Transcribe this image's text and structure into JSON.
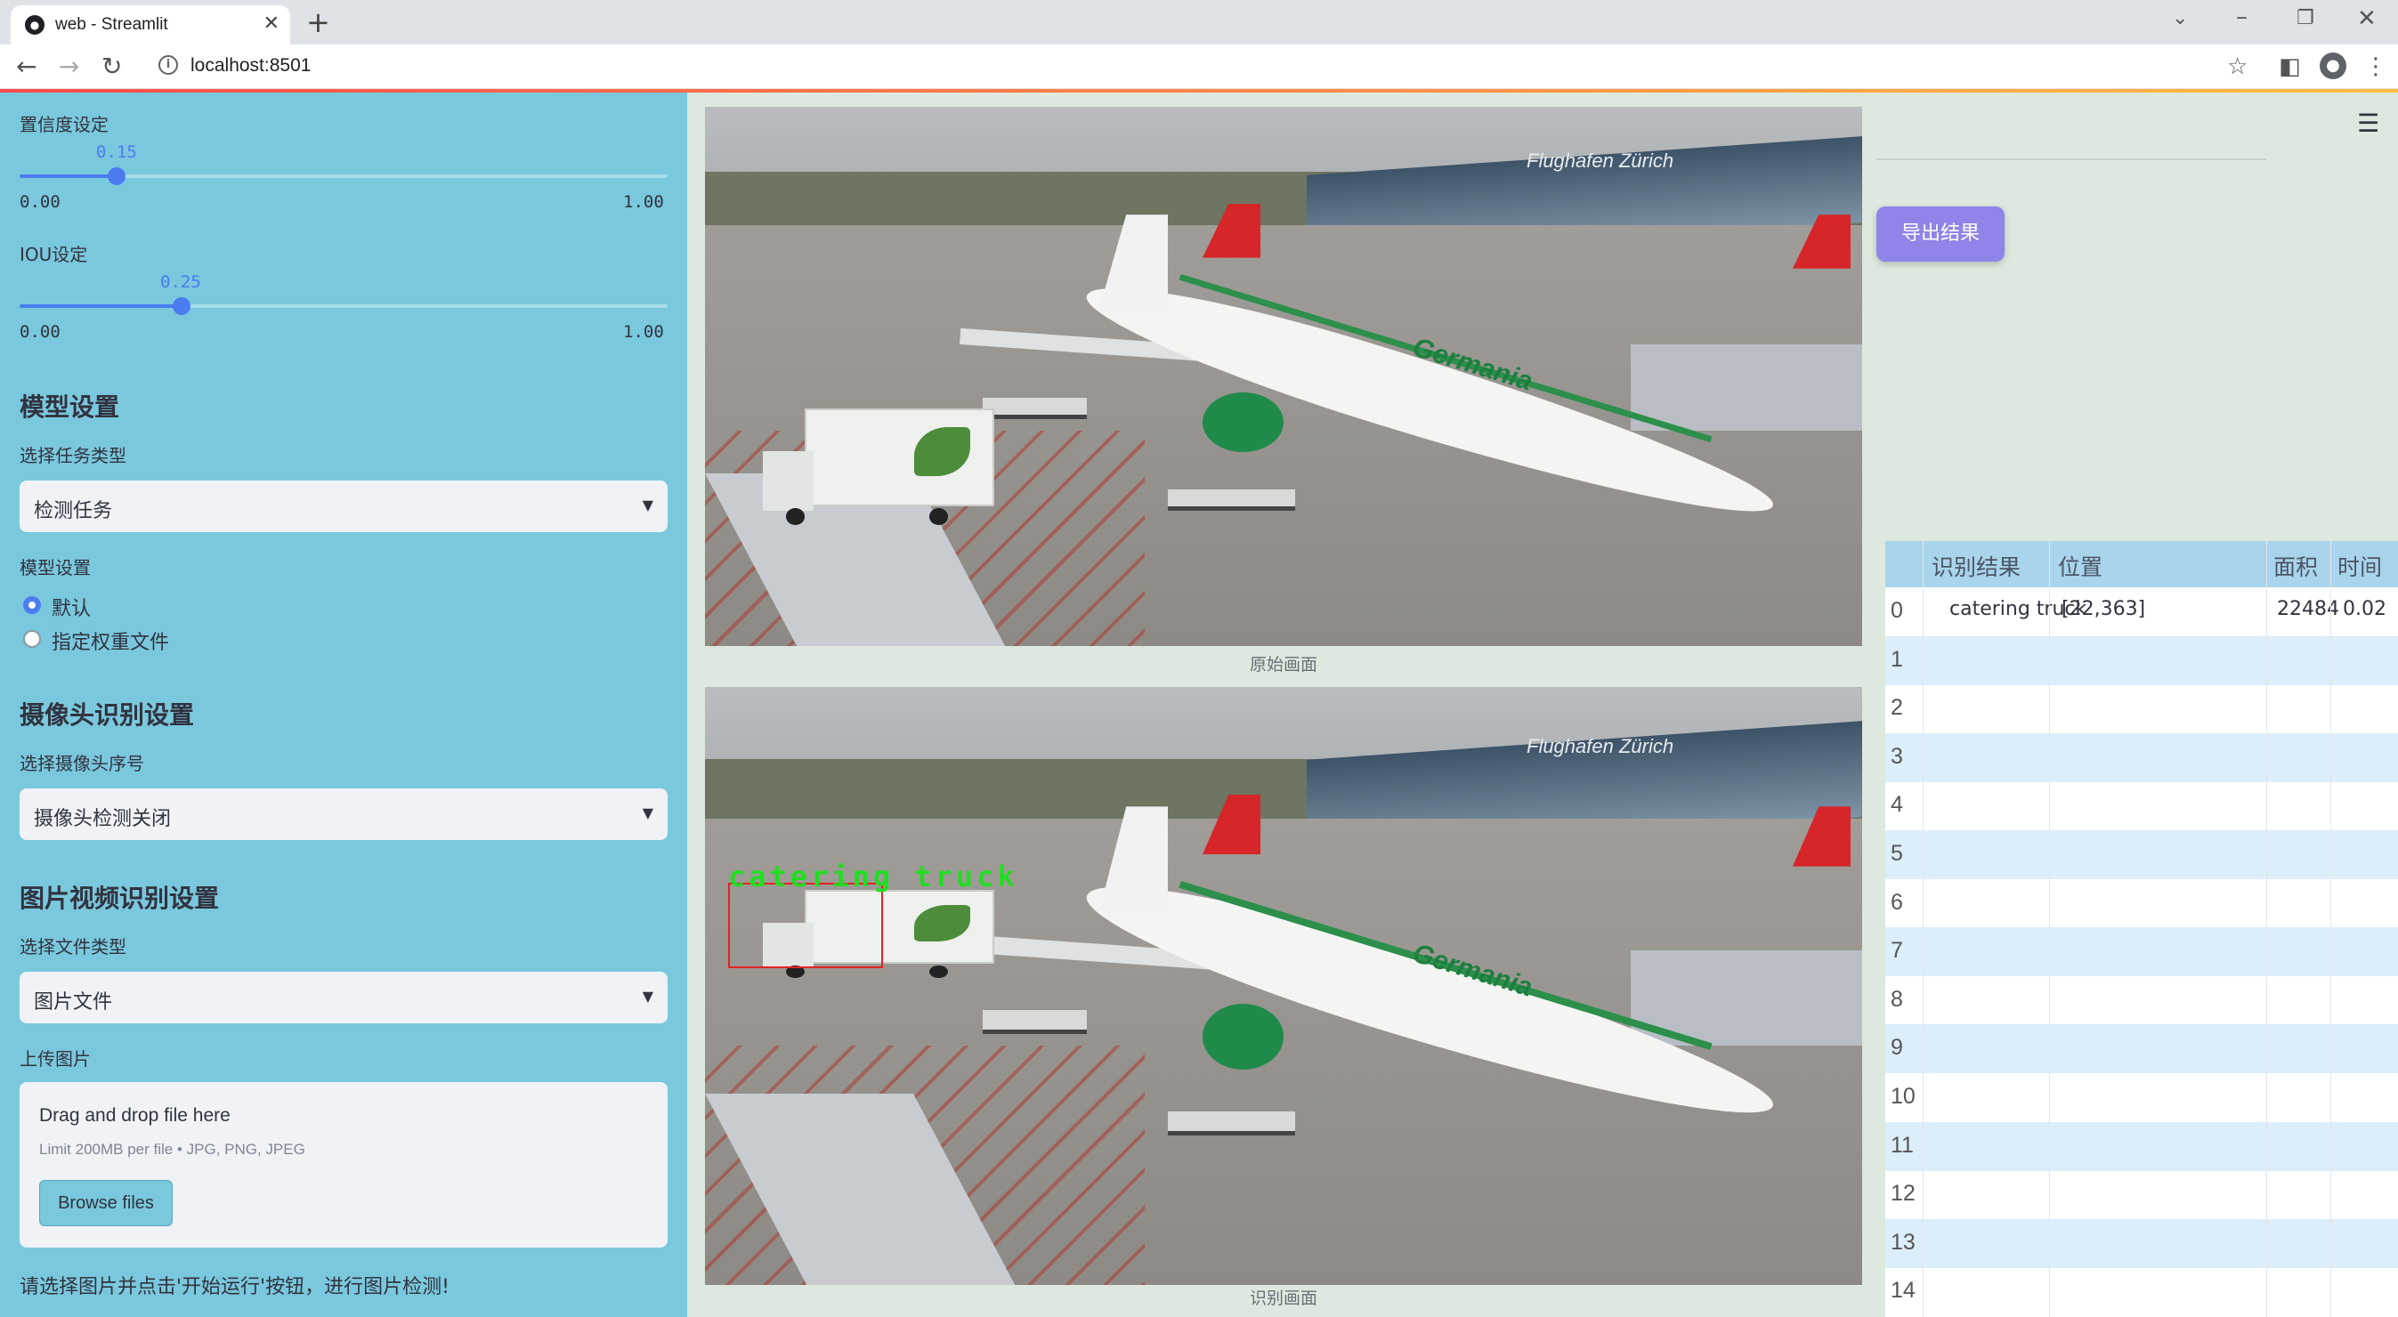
{
  "browser": {
    "tab_title": "web - Streamlit",
    "url": "localhost:8501"
  },
  "sidebar": {
    "confidence": {
      "label": "置信度设定",
      "value": "0.15",
      "value_fraction": 0.15,
      "min": "0.00",
      "max": "1.00"
    },
    "iou": {
      "label": "IOU设定",
      "value": "0.25",
      "value_fraction": 0.25,
      "min": "0.00",
      "max": "1.00"
    },
    "model_heading": "模型设置",
    "task_type_label": "选择任务类型",
    "task_type_value": "检测任务",
    "model_label": "模型设置",
    "model_options": [
      {
        "label": "默认",
        "selected": true
      },
      {
        "label": "指定权重文件",
        "selected": false
      }
    ],
    "camera_heading": "摄像头识别设置",
    "camera_label": "选择摄像头序号",
    "camera_value": "摄像头检测关闭",
    "file_heading": "图片视频识别设置",
    "file_type_label": "选择文件类型",
    "file_type_value": "图片文件",
    "upload_label": "上传图片",
    "uploader": {
      "title": "Drag and drop file here",
      "limit": "Limit 200MB per file • JPG, PNG, JPEG",
      "browse": "Browse files"
    },
    "hint": "请选择图片并点击'开始运行'按钮，进行图片检测!"
  },
  "main": {
    "original_caption": "原始画面",
    "result_caption": "识别画面",
    "detection_label": "catering truck",
    "scene_text": "Flughafen Zürich",
    "plane_text": "Germania",
    "export_button": "导出结果"
  },
  "table": {
    "headers": [
      "识别结果",
      "位置",
      "面积",
      "时间"
    ],
    "rows": [
      {
        "index": "0",
        "result": "catering truck",
        "position": "[22,363]",
        "area": "22484",
        "time": "0.02"
      },
      {
        "index": "1"
      },
      {
        "index": "2"
      },
      {
        "index": "3"
      },
      {
        "index": "4"
      },
      {
        "index": "5"
      },
      {
        "index": "6"
      },
      {
        "index": "7"
      },
      {
        "index": "8"
      },
      {
        "index": "9"
      },
      {
        "index": "10"
      },
      {
        "index": "11"
      },
      {
        "index": "12"
      },
      {
        "index": "13"
      },
      {
        "index": "14"
      }
    ]
  },
  "colors": {
    "sidebar_bg": "#7ac8dd",
    "main_bg": "#dde9de",
    "accent": "#4a7cf0",
    "export_button": "#8f84e8",
    "detection_box": "#e02424",
    "detection_text": "#22dd22"
  }
}
